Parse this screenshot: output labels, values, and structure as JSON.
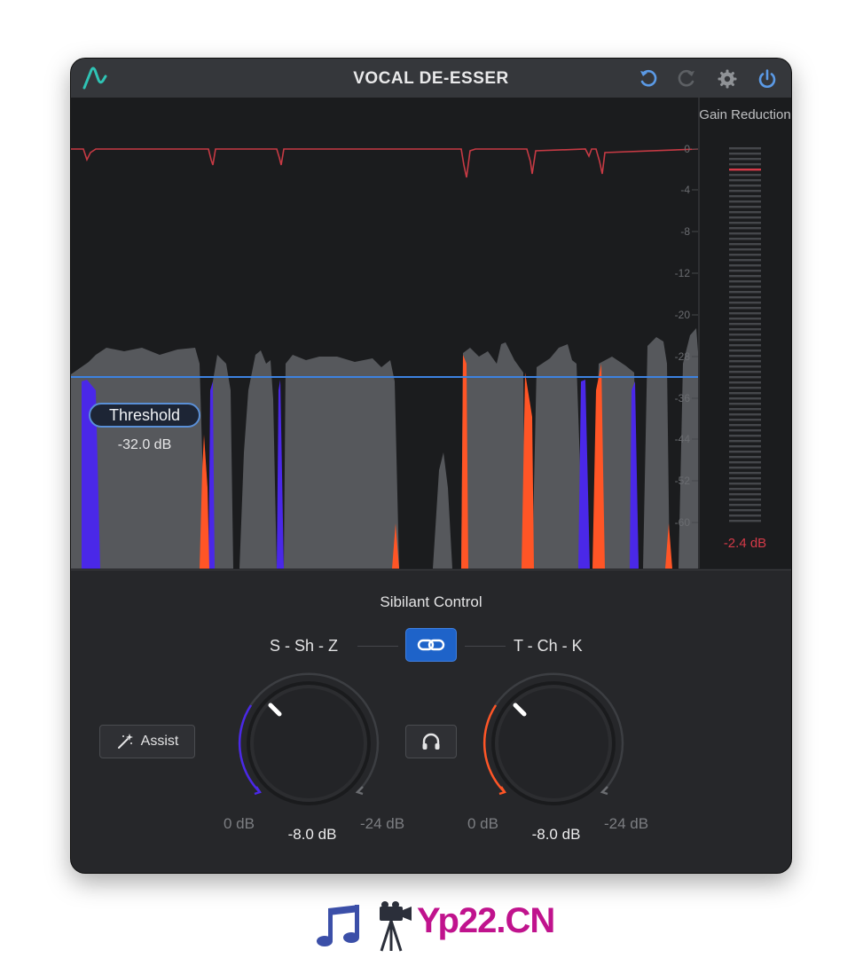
{
  "window": {
    "title": "VOCAL DE-ESSER",
    "buttons": [
      "undo",
      "redo",
      "settings",
      "power"
    ]
  },
  "display": {
    "threshold_label": "Threshold",
    "threshold_value": "-32.0 dB",
    "scale_ticks": [
      "0",
      "-4",
      "-8",
      "-12",
      "-20",
      "-28",
      "-36",
      "-44",
      "-52",
      "-60"
    ],
    "gain_reduction_label": "Gain Reduction",
    "gain_reduction_value": "-2.4 dB",
    "colors": {
      "threshold_line": "#3d82e0",
      "gain_trace": "#c73a44",
      "band_sh": "#4a28e8",
      "band_tch": "#ff5526",
      "waveform": "#56585c"
    }
  },
  "controls": {
    "section_title": "Sibilant Control",
    "left_band_label": "S - Sh - Z",
    "right_band_label": "T - Ch - K",
    "link_icon": "link-icon",
    "assist_label": "Assist",
    "listen_icon": "headphones-icon",
    "left_knob": {
      "min_label": "0 dB",
      "max_label": "-24 dB",
      "value": "-8.0 dB",
      "accent": "#4a28e8",
      "level": 0.33
    },
    "right_knob": {
      "min_label": "0 dB",
      "max_label": "-24 dB",
      "value": "-8.0 dB",
      "accent": "#ff5526",
      "level": 0.33
    }
  },
  "watermark": {
    "text": "Yp22.CN"
  }
}
